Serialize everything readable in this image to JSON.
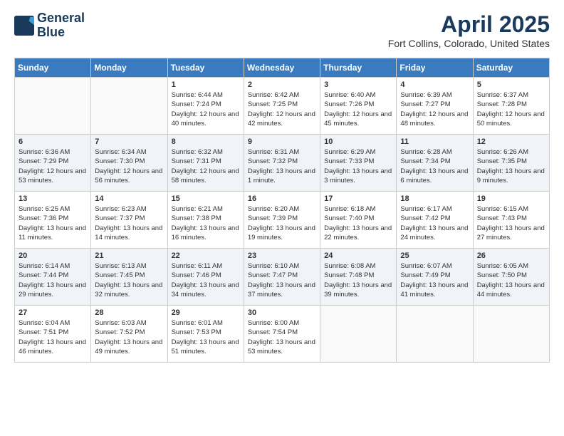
{
  "header": {
    "logo_line1": "General",
    "logo_line2": "Blue",
    "title": "April 2025",
    "subtitle": "Fort Collins, Colorado, United States"
  },
  "days_of_week": [
    "Sunday",
    "Monday",
    "Tuesday",
    "Wednesday",
    "Thursday",
    "Friday",
    "Saturday"
  ],
  "weeks": [
    [
      {
        "day": "",
        "info": ""
      },
      {
        "day": "",
        "info": ""
      },
      {
        "day": "1",
        "info": "Sunrise: 6:44 AM\nSunset: 7:24 PM\nDaylight: 12 hours and 40 minutes."
      },
      {
        "day": "2",
        "info": "Sunrise: 6:42 AM\nSunset: 7:25 PM\nDaylight: 12 hours and 42 minutes."
      },
      {
        "day": "3",
        "info": "Sunrise: 6:40 AM\nSunset: 7:26 PM\nDaylight: 12 hours and 45 minutes."
      },
      {
        "day": "4",
        "info": "Sunrise: 6:39 AM\nSunset: 7:27 PM\nDaylight: 12 hours and 48 minutes."
      },
      {
        "day": "5",
        "info": "Sunrise: 6:37 AM\nSunset: 7:28 PM\nDaylight: 12 hours and 50 minutes."
      }
    ],
    [
      {
        "day": "6",
        "info": "Sunrise: 6:36 AM\nSunset: 7:29 PM\nDaylight: 12 hours and 53 minutes."
      },
      {
        "day": "7",
        "info": "Sunrise: 6:34 AM\nSunset: 7:30 PM\nDaylight: 12 hours and 56 minutes."
      },
      {
        "day": "8",
        "info": "Sunrise: 6:32 AM\nSunset: 7:31 PM\nDaylight: 12 hours and 58 minutes."
      },
      {
        "day": "9",
        "info": "Sunrise: 6:31 AM\nSunset: 7:32 PM\nDaylight: 13 hours and 1 minute."
      },
      {
        "day": "10",
        "info": "Sunrise: 6:29 AM\nSunset: 7:33 PM\nDaylight: 13 hours and 3 minutes."
      },
      {
        "day": "11",
        "info": "Sunrise: 6:28 AM\nSunset: 7:34 PM\nDaylight: 13 hours and 6 minutes."
      },
      {
        "day": "12",
        "info": "Sunrise: 6:26 AM\nSunset: 7:35 PM\nDaylight: 13 hours and 9 minutes."
      }
    ],
    [
      {
        "day": "13",
        "info": "Sunrise: 6:25 AM\nSunset: 7:36 PM\nDaylight: 13 hours and 11 minutes."
      },
      {
        "day": "14",
        "info": "Sunrise: 6:23 AM\nSunset: 7:37 PM\nDaylight: 13 hours and 14 minutes."
      },
      {
        "day": "15",
        "info": "Sunrise: 6:21 AM\nSunset: 7:38 PM\nDaylight: 13 hours and 16 minutes."
      },
      {
        "day": "16",
        "info": "Sunrise: 6:20 AM\nSunset: 7:39 PM\nDaylight: 13 hours and 19 minutes."
      },
      {
        "day": "17",
        "info": "Sunrise: 6:18 AM\nSunset: 7:40 PM\nDaylight: 13 hours and 22 minutes."
      },
      {
        "day": "18",
        "info": "Sunrise: 6:17 AM\nSunset: 7:42 PM\nDaylight: 13 hours and 24 minutes."
      },
      {
        "day": "19",
        "info": "Sunrise: 6:15 AM\nSunset: 7:43 PM\nDaylight: 13 hours and 27 minutes."
      }
    ],
    [
      {
        "day": "20",
        "info": "Sunrise: 6:14 AM\nSunset: 7:44 PM\nDaylight: 13 hours and 29 minutes."
      },
      {
        "day": "21",
        "info": "Sunrise: 6:13 AM\nSunset: 7:45 PM\nDaylight: 13 hours and 32 minutes."
      },
      {
        "day": "22",
        "info": "Sunrise: 6:11 AM\nSunset: 7:46 PM\nDaylight: 13 hours and 34 minutes."
      },
      {
        "day": "23",
        "info": "Sunrise: 6:10 AM\nSunset: 7:47 PM\nDaylight: 13 hours and 37 minutes."
      },
      {
        "day": "24",
        "info": "Sunrise: 6:08 AM\nSunset: 7:48 PM\nDaylight: 13 hours and 39 minutes."
      },
      {
        "day": "25",
        "info": "Sunrise: 6:07 AM\nSunset: 7:49 PM\nDaylight: 13 hours and 41 minutes."
      },
      {
        "day": "26",
        "info": "Sunrise: 6:05 AM\nSunset: 7:50 PM\nDaylight: 13 hours and 44 minutes."
      }
    ],
    [
      {
        "day": "27",
        "info": "Sunrise: 6:04 AM\nSunset: 7:51 PM\nDaylight: 13 hours and 46 minutes."
      },
      {
        "day": "28",
        "info": "Sunrise: 6:03 AM\nSunset: 7:52 PM\nDaylight: 13 hours and 49 minutes."
      },
      {
        "day": "29",
        "info": "Sunrise: 6:01 AM\nSunset: 7:53 PM\nDaylight: 13 hours and 51 minutes."
      },
      {
        "day": "30",
        "info": "Sunrise: 6:00 AM\nSunset: 7:54 PM\nDaylight: 13 hours and 53 minutes."
      },
      {
        "day": "",
        "info": ""
      },
      {
        "day": "",
        "info": ""
      },
      {
        "day": "",
        "info": ""
      }
    ]
  ]
}
